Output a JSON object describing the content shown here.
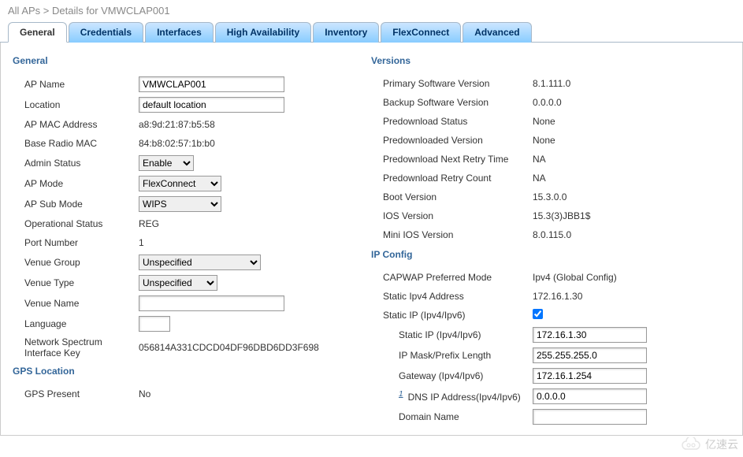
{
  "breadcrumb": "All APs > Details for VMWCLAP001",
  "tabs": [
    "General",
    "Credentials",
    "Interfaces",
    "High Availability",
    "Inventory",
    "FlexConnect",
    "Advanced"
  ],
  "general": {
    "title": "General",
    "apName": {
      "label": "AP Name",
      "value": "VMWCLAP001"
    },
    "location": {
      "label": "Location",
      "value": "default location"
    },
    "apMac": {
      "label": "AP MAC Address",
      "value": "a8:9d:21:87:b5:58"
    },
    "baseRadioMac": {
      "label": "Base Radio MAC",
      "value": "84:b8:02:57:1b:b0"
    },
    "adminStatus": {
      "label": "Admin Status",
      "value": "Enable"
    },
    "apMode": {
      "label": "AP Mode",
      "value": "FlexConnect"
    },
    "apSubMode": {
      "label": "AP Sub Mode",
      "value": "WIPS"
    },
    "opStatus": {
      "label": "Operational Status",
      "value": "REG"
    },
    "portNumber": {
      "label": "Port Number",
      "value": "1"
    },
    "venueGroup": {
      "label": "Venue Group",
      "value": "Unspecified"
    },
    "venueType": {
      "label": "Venue Type",
      "value": "Unspecified"
    },
    "venueName": {
      "label": "Venue Name",
      "value": ""
    },
    "language": {
      "label": "Language",
      "value": ""
    },
    "nsiKey": {
      "label": "Network Spectrum Interface Key",
      "value": "056814A331CDCD04DF96DBD6DD3F698"
    }
  },
  "gps": {
    "title": "GPS Location",
    "present": {
      "label": "GPS Present",
      "value": "No"
    }
  },
  "versions": {
    "title": "Versions",
    "primary": {
      "label": "Primary Software Version",
      "value": "8.1.111.0"
    },
    "backup": {
      "label": "Backup Software Version",
      "value": "0.0.0.0"
    },
    "predlStatus": {
      "label": "Predownload Status",
      "value": "None"
    },
    "predlVersion": {
      "label": "Predownloaded Version",
      "value": "None"
    },
    "predlNextRetry": {
      "label": "Predownload Next Retry Time",
      "value": "NA"
    },
    "predlRetryCount": {
      "label": "Predownload Retry Count",
      "value": "NA"
    },
    "boot": {
      "label": "Boot Version",
      "value": "15.3.0.0"
    },
    "ios": {
      "label": "IOS Version",
      "value": "15.3(3)JBB1$"
    },
    "miniIos": {
      "label": "Mini IOS Version",
      "value": "8.0.115.0"
    }
  },
  "ipconfig": {
    "title": "IP Config",
    "capwap": {
      "label": "CAPWAP Preferred Mode",
      "value": "Ipv4 (Global Config)"
    },
    "staticIpv4Addr": {
      "label": "Static Ipv4 Address",
      "value": "172.16.1.30"
    },
    "staticIpEnable": {
      "label": "Static IP (Ipv4/Ipv6)",
      "checked": true
    },
    "staticIp": {
      "label": "Static IP (Ipv4/Ipv6)",
      "value": "172.16.1.30"
    },
    "mask": {
      "label": "IP Mask/Prefix Length",
      "value": "255.255.255.0"
    },
    "gateway": {
      "label": "Gateway (Ipv4/Ipv6)",
      "value": "172.16.1.254"
    },
    "dns": {
      "footnote": "1",
      "label": "DNS IP Address(Ipv4/Ipv6)",
      "value": "0.0.0.0"
    },
    "domain": {
      "label": "Domain Name",
      "value": ""
    }
  },
  "watermark": "亿速云"
}
